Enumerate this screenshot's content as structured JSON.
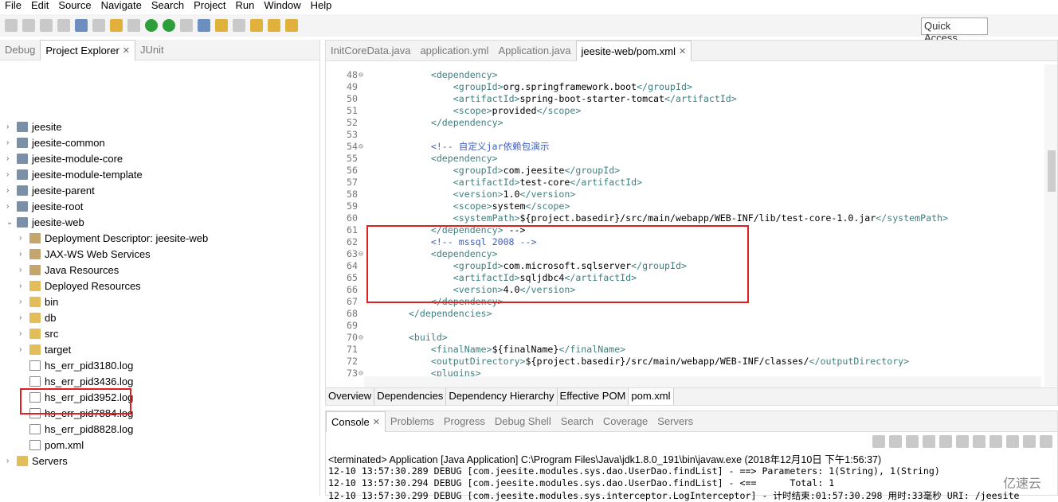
{
  "menu": [
    "File",
    "Edit",
    "Source",
    "Navigate",
    "Search",
    "Project",
    "Run",
    "Window",
    "Help"
  ],
  "quick_access": "Quick Access",
  "left_tabs": [
    {
      "label": "Debug"
    },
    {
      "label": "Project Explorer",
      "active": true
    },
    {
      "label": "JUnit"
    }
  ],
  "tree": [
    {
      "label": "jeesite",
      "depth": 0,
      "icon": "project"
    },
    {
      "label": "jeesite-common",
      "depth": 0,
      "icon": "project"
    },
    {
      "label": "jeesite-module-core",
      "depth": 0,
      "icon": "project"
    },
    {
      "label": "jeesite-module-template",
      "depth": 0,
      "icon": "project"
    },
    {
      "label": "jeesite-parent",
      "depth": 0,
      "icon": "project"
    },
    {
      "label": "jeesite-root",
      "depth": 0,
      "icon": "project"
    },
    {
      "label": "jeesite-web",
      "depth": 0,
      "icon": "project",
      "expanded": true
    },
    {
      "label": "Deployment Descriptor: jeesite-web",
      "depth": 1,
      "icon": "jar"
    },
    {
      "label": "JAX-WS Web Services",
      "depth": 1,
      "icon": "jar"
    },
    {
      "label": "Java Resources",
      "depth": 1,
      "icon": "jar"
    },
    {
      "label": "Deployed Resources",
      "depth": 1,
      "icon": "folder"
    },
    {
      "label": "bin",
      "depth": 1,
      "icon": "folder"
    },
    {
      "label": "db",
      "depth": 1,
      "icon": "folder"
    },
    {
      "label": "src",
      "depth": 1,
      "icon": "folder"
    },
    {
      "label": "target",
      "depth": 1,
      "icon": "folder"
    },
    {
      "label": "hs_err_pid3180.log",
      "depth": 1,
      "icon": "file",
      "leaf": true
    },
    {
      "label": "hs_err_pid3436.log",
      "depth": 1,
      "icon": "file",
      "leaf": true
    },
    {
      "label": "hs_err_pid3952.log",
      "depth": 1,
      "icon": "file",
      "leaf": true
    },
    {
      "label": "hs_err_pid7884.log",
      "depth": 1,
      "icon": "file",
      "leaf": true
    },
    {
      "label": "hs_err_pid8828.log",
      "depth": 1,
      "icon": "file",
      "leaf": true
    },
    {
      "label": "pom.xml",
      "depth": 1,
      "icon": "file",
      "leaf": true
    },
    {
      "label": "Servers",
      "depth": 0,
      "icon": "folder"
    }
  ],
  "editor_tabs": [
    {
      "label": "InitCoreData.java"
    },
    {
      "label": "application.yml"
    },
    {
      "label": "Application.java"
    },
    {
      "label": "jeesite-web/pom.xml",
      "active": true
    }
  ],
  "code_lines": [
    {
      "n": "48",
      "fold": true,
      "text": "        <dependency>"
    },
    {
      "n": "49",
      "text": "            <groupId>org.springframework.boot</groupId>"
    },
    {
      "n": "50",
      "text": "            <artifactId>spring-boot-starter-tomcat</artifactId>"
    },
    {
      "n": "51",
      "text": "            <scope>provided</scope>"
    },
    {
      "n": "52",
      "text": "        </dependency>"
    },
    {
      "n": "53",
      "text": ""
    },
    {
      "n": "54",
      "fold": true,
      "text": "        <!-- 自定义jar依赖包演示"
    },
    {
      "n": "55",
      "text": "        <dependency>"
    },
    {
      "n": "56",
      "text": "            <groupId>com.jeesite</groupId>"
    },
    {
      "n": "57",
      "text": "            <artifactId>test-core</artifactId>"
    },
    {
      "n": "58",
      "text": "            <version>1.0</version>"
    },
    {
      "n": "59",
      "text": "            <scope>system</scope>"
    },
    {
      "n": "60",
      "text": "            <systemPath>${project.basedir}/src/main/webapp/WEB-INF/lib/test-core-1.0.jar</systemPath>"
    },
    {
      "n": "61",
      "text": "        </dependency> -->"
    },
    {
      "n": "62",
      "text": "        <!-- mssql 2008 -->"
    },
    {
      "n": "63",
      "fold": true,
      "text": "        <dependency>"
    },
    {
      "n": "64",
      "text": "            <groupId>com.microsoft.sqlserver</groupId>"
    },
    {
      "n": "65",
      "text": "            <artifactId>sqljdbc4</artifactId>"
    },
    {
      "n": "66",
      "text": "            <version>4.0</version>"
    },
    {
      "n": "67",
      "text": "        </dependency>"
    },
    {
      "n": "68",
      "text": "    </dependencies>"
    },
    {
      "n": "69",
      "text": ""
    },
    {
      "n": "70",
      "fold": true,
      "text": "    <build>"
    },
    {
      "n": "71",
      "text": "        <finalName>${finalName}</finalName>"
    },
    {
      "n": "72",
      "text": "        <outputDirectory>${project.basedir}/src/main/webapp/WEB-INF/classes/</outputDirectory>"
    },
    {
      "n": "73",
      "fold": true,
      "text": "        <plugins>"
    }
  ],
  "pom_tabs": [
    {
      "label": "Overview"
    },
    {
      "label": "Dependencies"
    },
    {
      "label": "Dependency Hierarchy"
    },
    {
      "label": "Effective POM"
    },
    {
      "label": "pom.xml",
      "active": true
    }
  ],
  "console_tabs": [
    {
      "label": "Console",
      "active": true
    },
    {
      "label": "Problems"
    },
    {
      "label": "Progress"
    },
    {
      "label": "Debug Shell"
    },
    {
      "label": "Search"
    },
    {
      "label": "Coverage"
    },
    {
      "label": "Servers"
    }
  ],
  "console_header": "<terminated> Application [Java Application] C:\\Program Files\\Java\\jdk1.8.0_191\\bin\\javaw.exe (2018年12月10日 下午1:56:37)",
  "console_lines": [
    "12-10 13:57:30.289 DEBUG [com.jeesite.modules.sys.dao.UserDao.findList] - ==> Parameters: 1(String), 1(String)",
    "12-10 13:57:30.294 DEBUG [com.jeesite.modules.sys.dao.UserDao.findList] - <==      Total: 1",
    "12-10 13:57:30.299 DEBUG [com.jeesite.modules.sys.interceptor.LogInterceptor] - 计时结束:01:57:30.298 用时:33毫秒 URI: /jeesite"
  ],
  "watermark": "亿速云",
  "highlight_color": "#e02020"
}
